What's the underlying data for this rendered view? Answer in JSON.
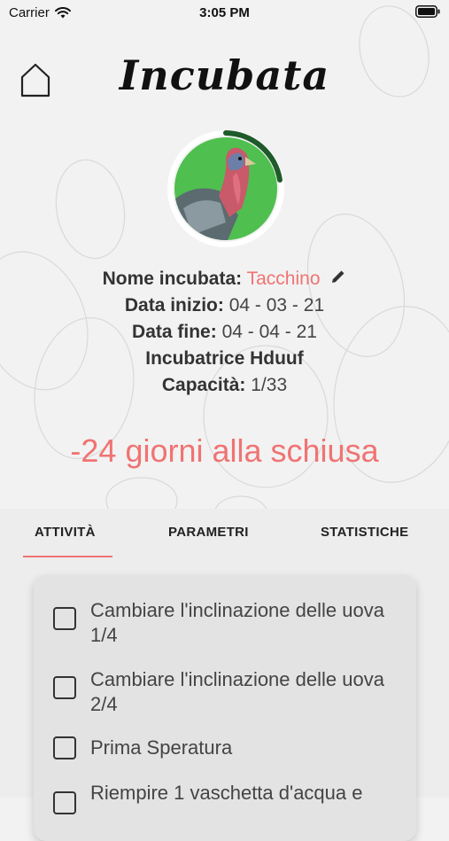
{
  "status": {
    "carrier": "Carrier",
    "time": "3:05 PM"
  },
  "header": {
    "title": "Incubata"
  },
  "info": {
    "name_label": "Nome incubata:",
    "name_value": "Tacchino",
    "start_label": "Data inizio:",
    "start_value": "04 - 03 - 21",
    "end_label": "Data fine:",
    "end_value": "04 - 04 - 21",
    "incubator": "Incubatrice Hduuf",
    "capacity_label": "Capacità:",
    "capacity_value": "1/33"
  },
  "countdown": "-24 giorni alla schiusa",
  "tabs": [
    {
      "label": "ATTIVITÀ",
      "active": true
    },
    {
      "label": "PARAMETRI",
      "active": false
    },
    {
      "label": "STATISTICHE",
      "active": false
    }
  ],
  "tasks": [
    {
      "text": "Cambiare l'inclinazione delle uova 1/4",
      "checked": false
    },
    {
      "text": "Cambiare l'inclinazione delle uova 2/4",
      "checked": false
    },
    {
      "text": "Prima Speratura",
      "checked": false
    },
    {
      "text": "Riempire 1 vaschetta d'acqua e",
      "checked": false
    }
  ],
  "colors": {
    "accent": "#f07373",
    "progress": "#1f5a2a",
    "background": "#f2f2f2"
  },
  "icons": {
    "home": "home-icon",
    "edit": "pencil-icon",
    "wifi": "wifi-icon",
    "battery": "battery-icon"
  }
}
